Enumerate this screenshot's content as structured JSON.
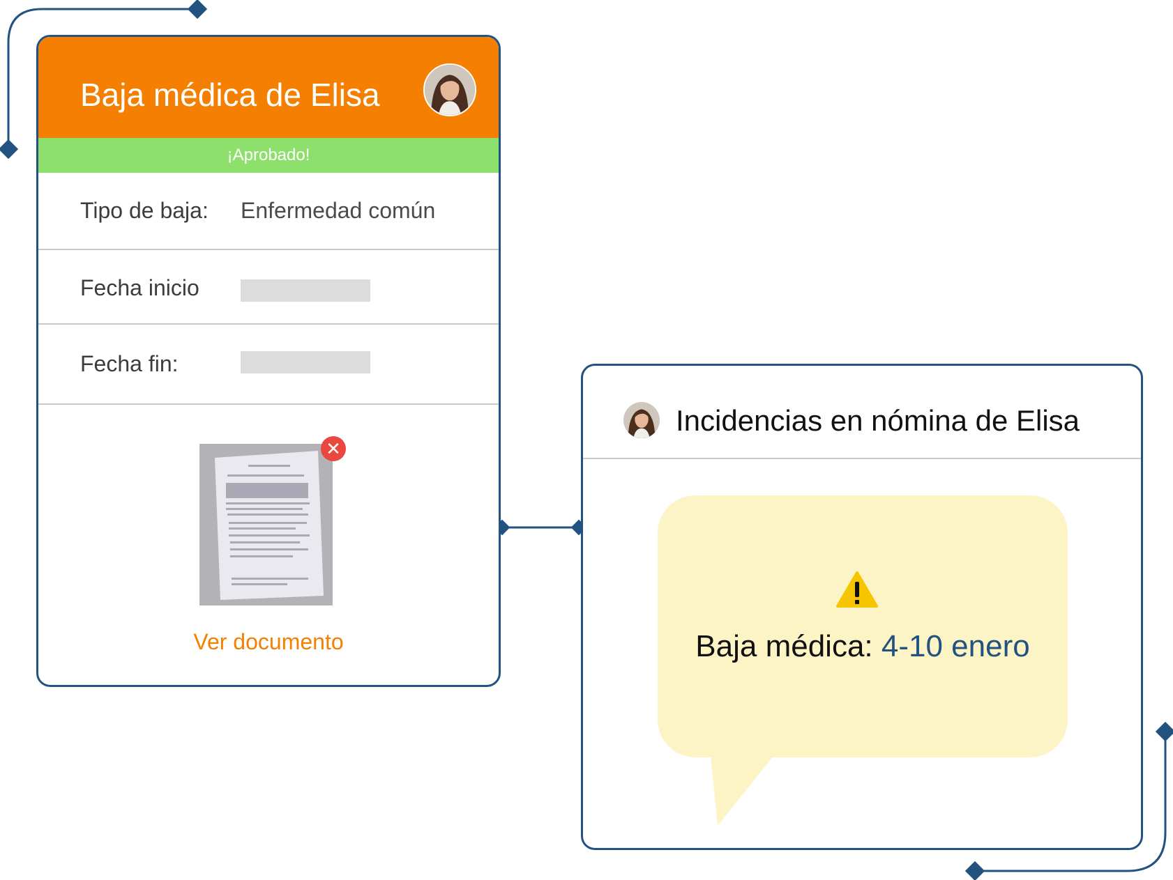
{
  "colors": {
    "brand_orange": "#f57f00",
    "approved_green": "#8ee06d",
    "connector_navy": "#22527f",
    "bubble_yellow": "#fdf4c5",
    "remove_red": "#e9473f",
    "placeholder_gray": "#dcdcdc"
  },
  "leave_card": {
    "title": "Baja médica de Elisa",
    "avatar_icon": "user-avatar-elisa",
    "status": "¡Aprobado!",
    "fields": [
      {
        "label": "Tipo de baja:",
        "value": "Enfermedad común"
      },
      {
        "label": "Fecha inicio",
        "value": ""
      },
      {
        "label": "Fecha fin:",
        "value": ""
      }
    ],
    "document": {
      "thumbnail_icon": "document-thumbnail",
      "remove_icon": "close-icon",
      "remove_glyph": "✕",
      "link_label": "Ver documento"
    }
  },
  "payroll_card": {
    "title": "Incidencias en nómina de Elisa",
    "avatar_icon": "user-avatar-elisa",
    "notice": {
      "icon": "warning-icon",
      "label": "Baja médica:",
      "dates": "4-10 enero"
    }
  }
}
